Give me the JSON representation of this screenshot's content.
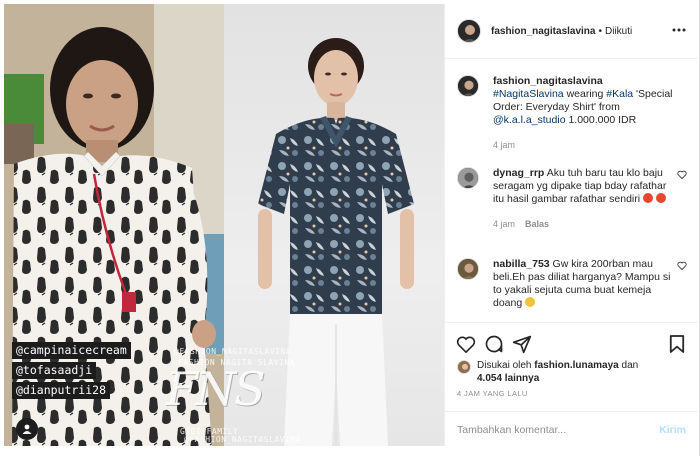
{
  "post": {
    "username": "fashion_nagitaslavina",
    "separator": "•",
    "follow_state": "Diikuti"
  },
  "media": {
    "tags": [
      "@campinaicecream",
      "@tofasaadji",
      "@dianputrii28"
    ],
    "watermark_handle": "@FASHION_NAGITASLAVINA",
    "watermark_name": "FASHION NAGITA SLAVINA",
    "watermark_family": "GIGI FAMILY",
    "logo_text": "FNS"
  },
  "caption": {
    "username": "fashion_nagitaslavina",
    "hashtag_1": "#NagitaSlavina",
    "text_1": "wearing",
    "hashtag_2": "#Kala",
    "text_2": "'Special Order: Everyday Shirt' from",
    "mention": "@k.a.l.a_studio",
    "text_3": "1.000.000 IDR",
    "time": "4 jam"
  },
  "comments": [
    {
      "username": "dynag_rrp",
      "text": "Aku tuh baru tau klo baju seragam yg dipake tiap bday rafathar itu hasil gambar rafathar sendiri",
      "time": "4 jam",
      "reply_label": "Balas"
    },
    {
      "username": "nabilla_753",
      "text": "Gw kira 200rban mau beli.Eh pas diliat harganya? Mampu si to yakali sejuta cuma buat kemeja doang"
    }
  ],
  "likes": {
    "prefix": "Disukai oleh",
    "liker": "fashion.lunamaya",
    "conjunction": "dan",
    "count": "4.054 lainnya"
  },
  "timestamp": "4 JAM YANG LALU",
  "comment_box": {
    "placeholder": "Tambahkan komentar...",
    "post_label": "Kirim"
  },
  "colors": {
    "link": "#00376b",
    "secondary_text": "#8e8e8e",
    "post_button": "#b2dffc",
    "border": "#efefef"
  },
  "icons": [
    "more-icon",
    "heart-icon",
    "comment-icon",
    "share-icon",
    "bookmark-icon",
    "user-tag-icon"
  ]
}
